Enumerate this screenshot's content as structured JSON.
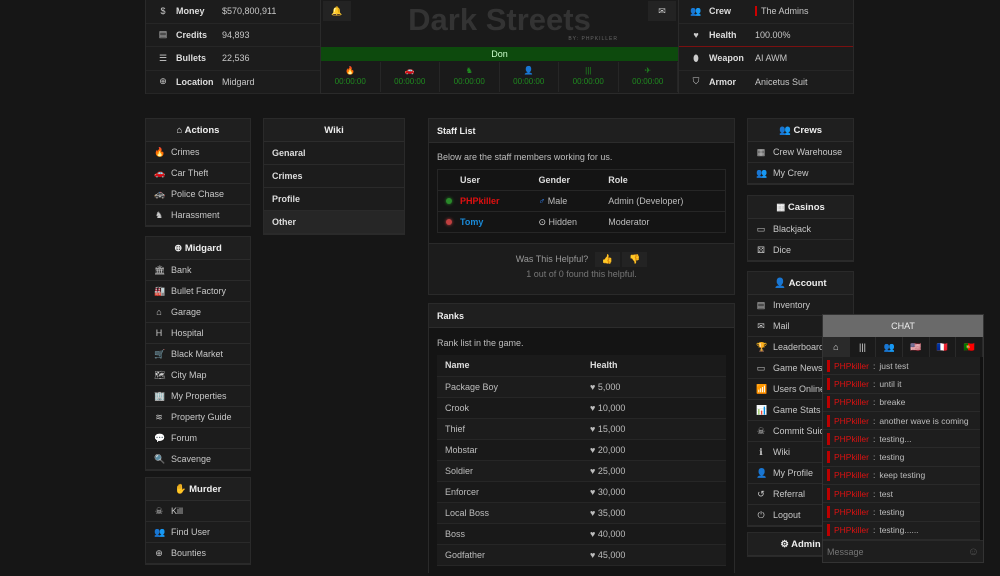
{
  "stats_left": [
    {
      "icon": "dollar-icon",
      "glyph": "$",
      "label": "Money",
      "value": "$570,800,911"
    },
    {
      "icon": "credits-icon",
      "glyph": "▤",
      "label": "Credits",
      "value": "94,893"
    },
    {
      "icon": "bullets-icon",
      "glyph": "☰",
      "label": "Bullets",
      "value": "22,536"
    },
    {
      "icon": "uk-flag-icon",
      "glyph": "⊕",
      "label": "Location",
      "value": "Midgard"
    }
  ],
  "stats_right": [
    {
      "icon": "crew-icon",
      "glyph": "👥",
      "label": "Crew",
      "value": "The Admins"
    },
    {
      "icon": "heart-icon",
      "glyph": "♥",
      "label": "Health",
      "value": "100.00%"
    },
    {
      "icon": "weapon-icon",
      "glyph": "⬮",
      "label": "Weapon",
      "value": "AI AWM"
    },
    {
      "icon": "shield-icon",
      "glyph": "⛉",
      "label": "Armor",
      "value": "Anicetus Suit"
    }
  ],
  "header": {
    "title": "Dark Streets",
    "subtitle": "BY: PHPKILLER",
    "rank": "Don",
    "rank_progress": 100
  },
  "timers": [
    {
      "icon": "fire-icon",
      "glyph": "🔥",
      "value": "00:00:00"
    },
    {
      "icon": "car-icon",
      "glyph": "🚗",
      "value": "00:00:00"
    },
    {
      "icon": "harass-icon",
      "glyph": "♞",
      "value": "00:00:00"
    },
    {
      "icon": "user-icon",
      "glyph": "👤",
      "value": "00:00:00"
    },
    {
      "icon": "jail-icon",
      "glyph": "|||",
      "value": "00:00:00"
    },
    {
      "icon": "plane-icon",
      "glyph": "✈",
      "value": "00:00:00"
    }
  ],
  "actions": {
    "title": "Actions",
    "items": [
      {
        "label": "Crimes",
        "glyph": "🔥"
      },
      {
        "label": "Car Theft",
        "glyph": "🚗"
      },
      {
        "label": "Police Chase",
        "glyph": "🚓"
      },
      {
        "label": "Harassment",
        "glyph": "♞"
      }
    ]
  },
  "city": {
    "title": "Midgard",
    "items": [
      {
        "label": "Bank",
        "glyph": "🏛"
      },
      {
        "label": "Bullet Factory",
        "glyph": "🏭"
      },
      {
        "label": "Garage",
        "glyph": "⌂"
      },
      {
        "label": "Hospital",
        "glyph": "H"
      },
      {
        "label": "Black Market",
        "glyph": "🛒"
      },
      {
        "label": "City Map",
        "glyph": "🗺"
      },
      {
        "label": "My Properties",
        "glyph": "🏢"
      },
      {
        "label": "Property Guide",
        "glyph": "≋"
      },
      {
        "label": "Forum",
        "glyph": "💬"
      },
      {
        "label": "Scavenge",
        "glyph": "🔍"
      }
    ]
  },
  "murder": {
    "title": "Murder",
    "items": [
      {
        "label": "Kill",
        "glyph": "☠"
      },
      {
        "label": "Find User",
        "glyph": "👥"
      },
      {
        "label": "Bounties",
        "glyph": "⊕"
      }
    ]
  },
  "wiki": {
    "title": "Wiki",
    "items": [
      "Genaral",
      "Crimes",
      "Profile",
      "Other"
    ]
  },
  "staff": {
    "title": "Staff List",
    "intro": "Below are the staff members working for us.",
    "columns": [
      "User",
      "Gender",
      "Role"
    ],
    "rows": [
      {
        "user": "PHPkiller",
        "color": "#e01010",
        "status": "#2a8a2a",
        "gender": "Male",
        "gender_glyph": "♂",
        "role": "Admin (Developer)"
      },
      {
        "user": "Tomy",
        "color": "#1a8ad8",
        "status": "#c04040",
        "gender": "Hidden",
        "gender_glyph": "⊙",
        "role": "Moderator"
      }
    ],
    "helpful_q": "Was This Helpful?",
    "helpful_count": "1 out of 0 found this helpful."
  },
  "ranks": {
    "title": "Ranks",
    "intro": "Rank list in the game.",
    "columns": [
      "Name",
      "Health"
    ],
    "rows": [
      [
        "Package Boy",
        "5,000"
      ],
      [
        "Crook",
        "10,000"
      ],
      [
        "Thief",
        "15,000"
      ],
      [
        "Mobstar",
        "20,000"
      ],
      [
        "Soldier",
        "25,000"
      ],
      [
        "Enforcer",
        "30,000"
      ],
      [
        "Local Boss",
        "35,000"
      ],
      [
        "Boss",
        "40,000"
      ],
      [
        "Godfather",
        "45,000"
      ]
    ]
  },
  "crews": {
    "title": "Crews",
    "items": [
      {
        "label": "Crew Warehouse",
        "glyph": "▦"
      },
      {
        "label": "My Crew",
        "glyph": "👥"
      }
    ]
  },
  "casinos": {
    "title": "Casinos",
    "items": [
      {
        "label": "Blackjack",
        "glyph": "▭"
      },
      {
        "label": "Dice",
        "glyph": "⚄"
      }
    ]
  },
  "account": {
    "title": "Account",
    "items": [
      {
        "label": "Inventory",
        "glyph": "▤"
      },
      {
        "label": "Mail",
        "glyph": "✉"
      },
      {
        "label": "Leaderboard",
        "glyph": "🏆"
      },
      {
        "label": "Game News",
        "glyph": "▭"
      },
      {
        "label": "Users Online",
        "glyph": "📶"
      },
      {
        "label": "Game Stats",
        "glyph": "📊"
      },
      {
        "label": "Commit Suicide",
        "glyph": "☠"
      },
      {
        "label": "Wiki",
        "glyph": "ℹ"
      },
      {
        "label": "My Profile",
        "glyph": "👤"
      },
      {
        "label": "Referral",
        "glyph": "↺"
      },
      {
        "label": "Logout",
        "glyph": "⏻"
      }
    ]
  },
  "admin": {
    "title": "Admin"
  },
  "chat": {
    "title": "CHAT",
    "tabs": [
      {
        "icon": "home-icon",
        "glyph": "⌂"
      },
      {
        "icon": "jail-icon",
        "glyph": "|||"
      },
      {
        "icon": "crew-icon",
        "glyph": "👥"
      },
      {
        "icon": "us-flag-icon",
        "glyph": "🇺🇸"
      },
      {
        "icon": "fr-flag-icon",
        "glyph": "🇫🇷"
      },
      {
        "icon": "pt-flag-icon",
        "glyph": "🇵🇹"
      }
    ],
    "messages": [
      {
        "user": "PHPkiller",
        "text": "just test"
      },
      {
        "user": "PHPkiller",
        "text": "until it"
      },
      {
        "user": "PHPkiller",
        "text": "breake"
      },
      {
        "user": "PHPkiller",
        "text": "another wave is coming"
      },
      {
        "user": "PHPkiller",
        "text": "testing..."
      },
      {
        "user": "PHPkiller",
        "text": "testing"
      },
      {
        "user": "PHPkiller",
        "text": "keep testing"
      },
      {
        "user": "PHPkiller",
        "text": "test"
      },
      {
        "user": "PHPkiller",
        "text": "testing"
      },
      {
        "user": "PHPkiller",
        "text": "testing......"
      }
    ],
    "placeholder": "Message"
  }
}
